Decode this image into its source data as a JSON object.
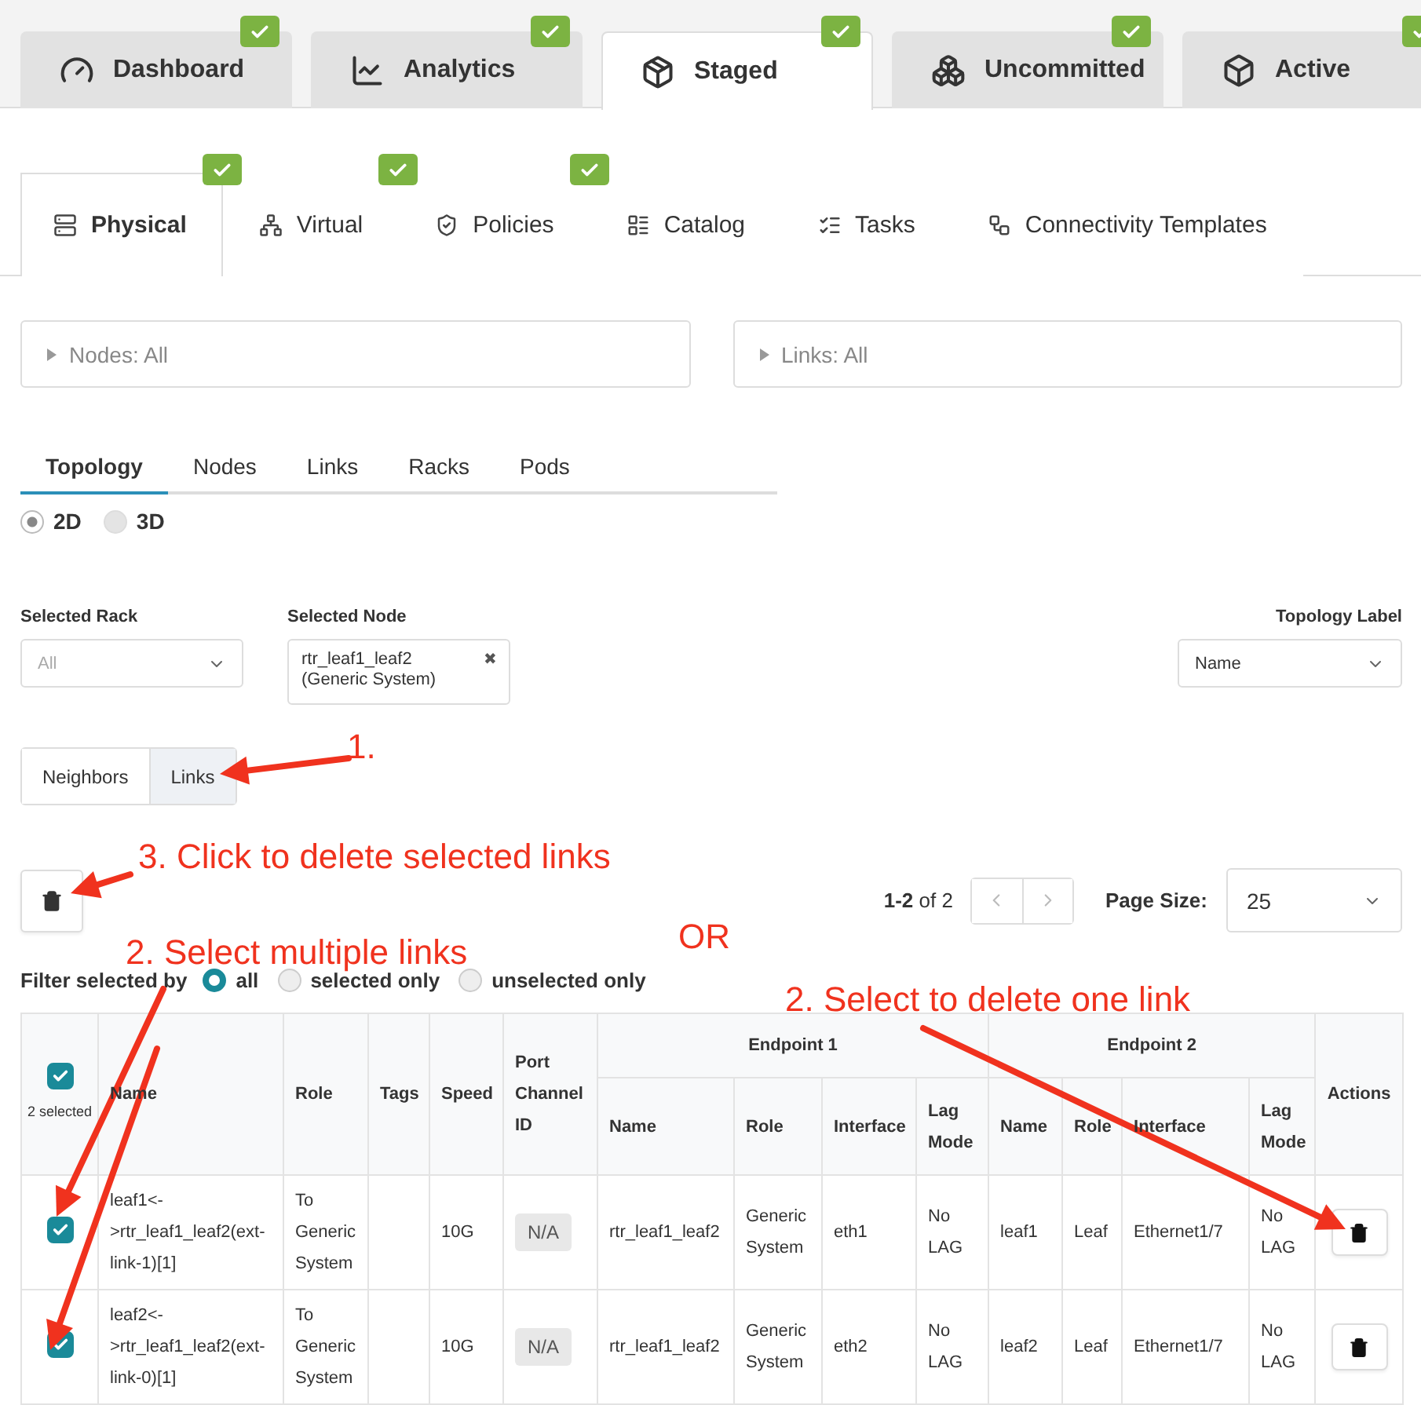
{
  "main_tabs": [
    {
      "label": "Dashboard",
      "selected": false,
      "badge": true
    },
    {
      "label": "Analytics",
      "selected": false,
      "badge": true
    },
    {
      "label": "Staged",
      "selected": true,
      "badge": true
    },
    {
      "label": "Uncommitted",
      "selected": false,
      "badge": true
    },
    {
      "label": "Active",
      "selected": false,
      "badge": true
    }
  ],
  "sub_tabs": [
    {
      "label": "Physical",
      "selected": true,
      "badge": true
    },
    {
      "label": "Virtual",
      "selected": false,
      "badge": true
    },
    {
      "label": "Policies",
      "selected": false,
      "badge": true
    },
    {
      "label": "Catalog",
      "selected": false,
      "badge": false
    },
    {
      "label": "Tasks",
      "selected": false,
      "badge": false
    },
    {
      "label": "Connectivity Templates",
      "selected": false,
      "badge": false
    }
  ],
  "filter_panels": [
    {
      "label": "Nodes: All",
      "expanded": false
    },
    {
      "label": "Links: All",
      "expanded": false
    }
  ],
  "view_tabs": [
    {
      "label": "Topology",
      "selected": true
    },
    {
      "label": "Nodes",
      "selected": false
    },
    {
      "label": "Links",
      "selected": false
    },
    {
      "label": "Racks",
      "selected": false
    },
    {
      "label": "Pods",
      "selected": false
    }
  ],
  "dimension_options": [
    {
      "label": "2D",
      "selected": true
    },
    {
      "label": "3D",
      "selected": false
    }
  ],
  "selected_rack": {
    "label": "Selected Rack",
    "placeholder": "All"
  },
  "selected_node": {
    "label": "Selected Node",
    "value": "rtr_leaf1_leaf2 (Generic System)",
    "clear": "✖"
  },
  "topology_label": {
    "label": "Topology Label",
    "value": "Name"
  },
  "segments": [
    {
      "label": "Neighbors",
      "selected": false
    },
    {
      "label": "Links",
      "selected": true
    }
  ],
  "pagination": {
    "range": "1-2",
    "of": "of 2",
    "page_size_label": "Page Size:",
    "page_size": "25"
  },
  "filter_selected": {
    "label": "Filter selected by",
    "options": [
      {
        "label": "all",
        "selected": true
      },
      {
        "label": "selected only",
        "selected": false
      },
      {
        "label": "unselected only",
        "selected": false
      }
    ]
  },
  "table": {
    "select_all": {
      "checked": true,
      "label": "2 selected"
    },
    "columns": [
      "Name",
      "Role",
      "Tags",
      "Speed",
      "Port Channel ID"
    ],
    "endpoint_groups": [
      {
        "title": "Endpoint 1",
        "columns": [
          "Name",
          "Role",
          "Interface",
          "Lag Mode"
        ]
      },
      {
        "title": "Endpoint 2",
        "columns": [
          "Name",
          "Role",
          "Interface",
          "Lag Mode"
        ]
      }
    ],
    "actions_header": "Actions",
    "rows": [
      {
        "checked": true,
        "name": "leaf1<->rtr_leaf1_leaf2(ext-link-1)[1]",
        "role": "To Generic System",
        "speed": "10G",
        "port_channel": "N/A",
        "ep1": [
          "rtr_leaf1_leaf2",
          "Generic System",
          "eth1",
          "No LAG"
        ],
        "ep2": [
          "leaf1",
          "Leaf",
          "Ethernet1/7",
          "No LAG"
        ]
      },
      {
        "checked": true,
        "name": "leaf2<->rtr_leaf1_leaf2(ext-link-0)[1]",
        "role": "To Generic System",
        "speed": "10G",
        "port_channel": "N/A",
        "ep1": [
          "rtr_leaf1_leaf2",
          "Generic System",
          "eth2",
          "No LAG"
        ],
        "ep2": [
          "leaf2",
          "Leaf",
          "Ethernet1/7",
          "No LAG"
        ]
      }
    ]
  },
  "annotations": [
    {
      "text": "1."
    },
    {
      "text": "3. Click to delete selected links"
    },
    {
      "text": "2. Select multiple links"
    },
    {
      "text": "OR"
    },
    {
      "text": "2. Select to delete one link"
    }
  ]
}
